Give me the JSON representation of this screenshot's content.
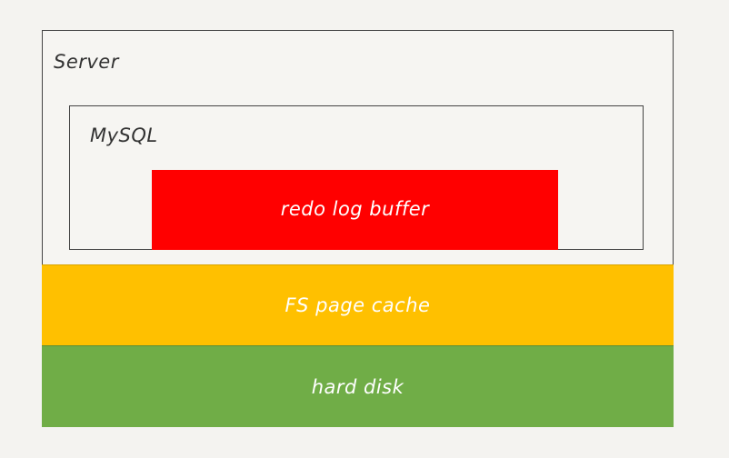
{
  "diagram": {
    "server": {
      "label": "Server"
    },
    "mysql": {
      "label": "MySQL"
    },
    "redo_log_buffer": {
      "label": "redo log buffer",
      "color": "#ff0000"
    },
    "fs_page_cache": {
      "label": "FS page cache",
      "color": "#ffc000"
    },
    "hard_disk": {
      "label": "hard disk",
      "color": "#70ad47"
    }
  }
}
